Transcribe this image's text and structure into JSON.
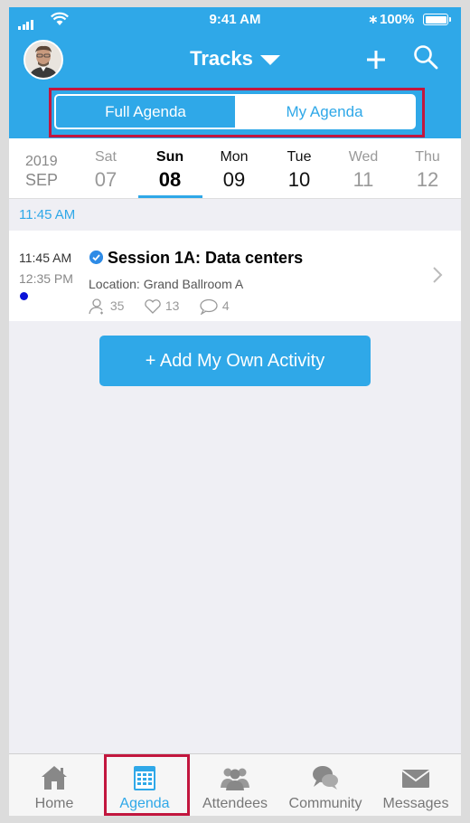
{
  "status_bar": {
    "time": "9:41 AM",
    "battery_percent": "100%",
    "bluetooth_glyph": "∗"
  },
  "header": {
    "title": "Tracks",
    "avatar_icon": "user-avatar",
    "add_icon": "plus-icon",
    "search_icon": "search-icon",
    "segments": {
      "full": "Full Agenda",
      "mine": "My Agenda",
      "selected": "Full Agenda"
    }
  },
  "date_strip": {
    "year": "2019",
    "month": "SEP",
    "days": [
      {
        "name": "Sat",
        "num": "07"
      },
      {
        "name": "Sun",
        "num": "08"
      },
      {
        "name": "Mon",
        "num": "09"
      },
      {
        "name": "Tue",
        "num": "10"
      },
      {
        "name": "Wed",
        "num": "11"
      },
      {
        "name": "Thu",
        "num": "12"
      }
    ],
    "selected_day": "Sun"
  },
  "agenda": {
    "time_header": "11:45 AM",
    "sessions": [
      {
        "start": "11:45 AM",
        "end": "12:35 PM",
        "title": "Session 1A: Data centers",
        "location": "Location: Grand Ballroom A",
        "attendees": "35",
        "likes": "13",
        "comments": "4",
        "dot_color": "#0a12d8"
      }
    ],
    "add_button": "+ Add My Own Activity"
  },
  "tabbar": {
    "items": [
      {
        "label": "Home",
        "icon": "home-icon"
      },
      {
        "label": "Agenda",
        "icon": "calendar-icon"
      },
      {
        "label": "Attendees",
        "icon": "people-icon"
      },
      {
        "label": "Community",
        "icon": "chat-bubbles-icon"
      },
      {
        "label": "Messages",
        "icon": "envelope-icon"
      }
    ],
    "active": "Agenda"
  },
  "colors": {
    "accent": "#2fa8e8",
    "highlight": "#c2163e"
  }
}
